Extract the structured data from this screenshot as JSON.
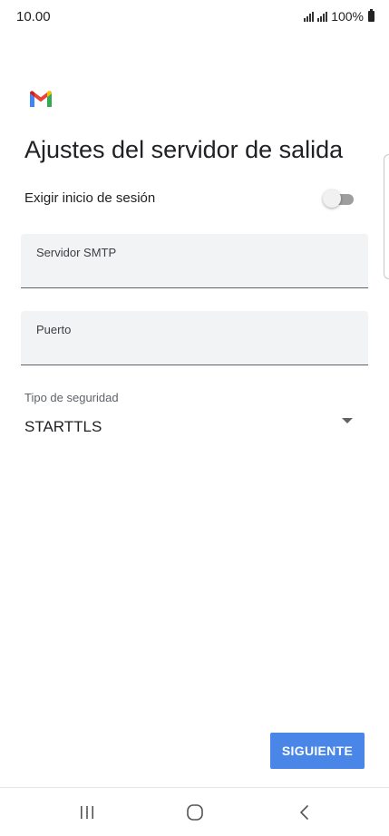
{
  "status_bar": {
    "time": "10.00",
    "battery": "100%"
  },
  "app": {
    "logo_icon": "gmail-logo-icon"
  },
  "title": "Ajustes del servidor de salida",
  "login_required": {
    "label": "Exigir inicio de sesión",
    "enabled": false
  },
  "fields": {
    "smtp_server": {
      "label": "Servidor SMTP",
      "value": ""
    },
    "port": {
      "label": "Puerto",
      "value": ""
    }
  },
  "security": {
    "label": "Tipo de seguridad",
    "selected": "STARTTLS"
  },
  "actions": {
    "next_label": "SIGUIENTE"
  },
  "colors": {
    "primary_button": "#4a86e8",
    "field_background": "#f1f3f4"
  },
  "nav": {
    "recents_icon": "recents-icon",
    "home_icon": "home-icon",
    "back_icon": "back-icon"
  }
}
